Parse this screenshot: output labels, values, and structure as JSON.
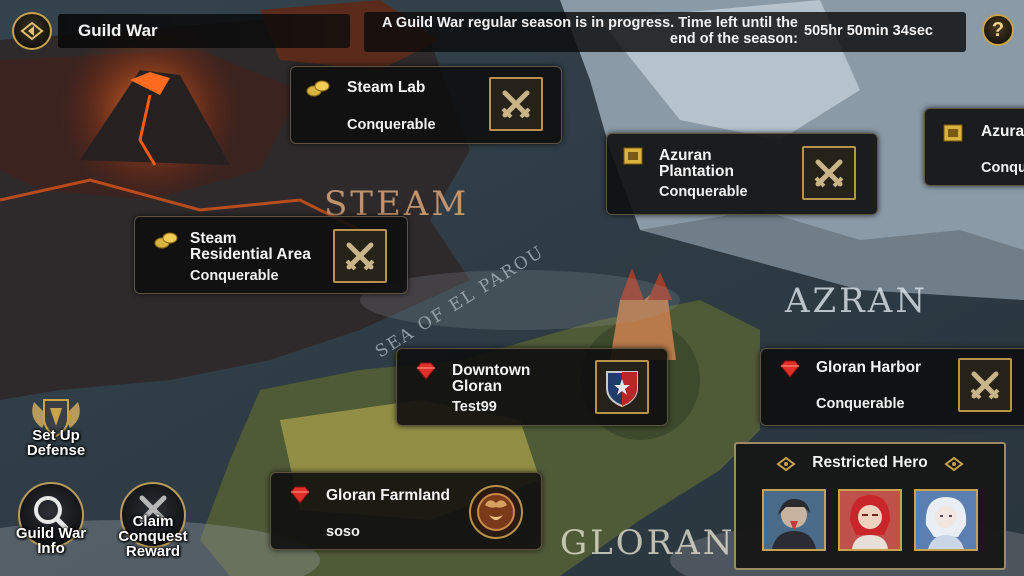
{
  "header": {
    "title": "Guild War",
    "season_line1": "A Guild War regular season is in progress. Time left until the",
    "season_line2": "end of the season:",
    "time_left": "505hr 50min 34sec",
    "help_label": "?"
  },
  "map_labels": {
    "steam": "STEAM",
    "azran": "AZRAN",
    "gloran": "GLORAN",
    "sea": "SEA OF EL PAROU"
  },
  "territories": {
    "steam_lab": {
      "name": "Steam Lab",
      "status": "Conquerable",
      "icon": "gold-coins-icon",
      "emblem": "crossed-swords-icon"
    },
    "steam_residential": {
      "name_line1": "Steam",
      "name_line2": "Residential Area",
      "status": "Conquerable",
      "icon": "gold-coins-icon",
      "emblem": "crossed-swords-icon"
    },
    "azuran_plantation": {
      "name_line1": "Azuran",
      "name_line2": "Plantation",
      "status": "Conquerable",
      "icon": "gold-crest-icon",
      "emblem": "crossed-swords-icon"
    },
    "azuran_partial": {
      "name": "Azura",
      "status": "Conqu",
      "icon": "gold-crest-icon"
    },
    "downtown_gloran": {
      "name_line1": "Downtown",
      "name_line2": "Gloran",
      "status": "Test99",
      "icon": "red-gem-icon",
      "emblem": "guild-shield-icon"
    },
    "gloran_harbor": {
      "name": "Gloran Harbor",
      "status": "Conquerable",
      "icon": "red-gem-icon",
      "emblem": "crossed-swords-icon"
    },
    "gloran_farmland": {
      "name": "Gloran Farmland",
      "status": "soso",
      "icon": "red-gem-icon",
      "emblem": "guild-emblem-icon"
    }
  },
  "side_buttons": {
    "setup_defense": {
      "line1": "Set Up",
      "line2": "Defense"
    },
    "guild_war_info": {
      "line1": "Guild War",
      "line2": "Info"
    },
    "claim_reward": {
      "line1": "Claim",
      "line2": "Conquest",
      "line3": "Reward"
    }
  },
  "restricted": {
    "title": "Restricted Hero",
    "heroes": [
      "hero-portrait-1",
      "hero-portrait-2",
      "hero-portrait-3"
    ]
  },
  "colors": {
    "gold": "#c9a24a",
    "panel": "#0e0e0e",
    "text": "#f2f2f2",
    "gem_red": "#e0302a"
  }
}
